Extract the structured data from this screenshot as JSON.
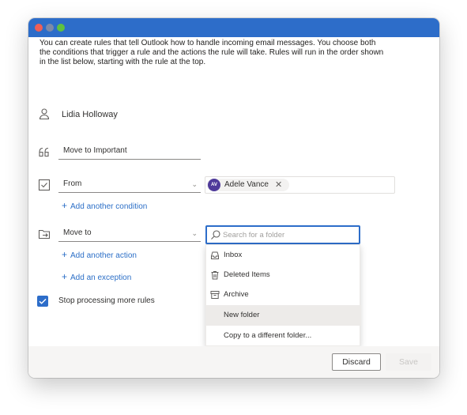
{
  "description": "You can create rules that tell Outlook how to handle incoming email messages. You choose both the conditions that trigger a rule and the actions the rule will take. Rules will run in the order shown in the list below, starting with the rule at the top.",
  "account": {
    "name": "Lidia Holloway"
  },
  "rule_name": {
    "value": "Move to Important"
  },
  "condition": {
    "field": "From",
    "recipient": {
      "initials": "AV",
      "name": "Adele Vance",
      "avatar_color": "#4f3a9a"
    },
    "add_link": "Add another condition"
  },
  "action": {
    "field": "Move to",
    "search_placeholder": "Search for a folder",
    "add_link": "Add another action",
    "exception_link": "Add an exception"
  },
  "folders": [
    {
      "label": "Inbox",
      "icon": "inbox-icon"
    },
    {
      "label": "Deleted Items",
      "icon": "trash-icon"
    },
    {
      "label": "Archive",
      "icon": "archive-icon"
    },
    {
      "label": "New folder",
      "icon": ""
    },
    {
      "label": "Copy to a different folder...",
      "icon": ""
    }
  ],
  "stop_processing": {
    "label": "Stop processing more rules",
    "checked": true
  },
  "buttons": {
    "discard": "Discard",
    "save": "Save"
  },
  "colors": {
    "accent": "#2d6dc9",
    "link": "#2c6fc7",
    "titlebar": "#2d6dc9"
  }
}
